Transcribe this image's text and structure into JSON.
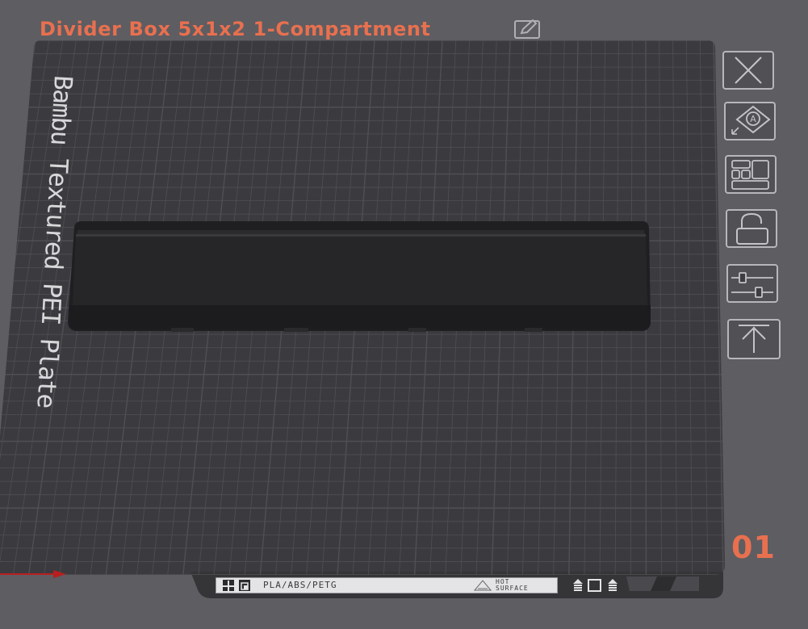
{
  "plate": {
    "title": "Divider Box 5x1x2 1-Compartment",
    "name": "Bambu Textured PEI Plate",
    "number": "01",
    "strip_label": "PLA/ABS/PETG",
    "hot_label_1": "HOT",
    "hot_label_2": "SURFACE"
  },
  "toolbar": {
    "buttons": [
      {
        "icon": "close-icon"
      },
      {
        "icon": "auto-orient-icon"
      },
      {
        "icon": "arrange-icon"
      },
      {
        "icon": "lock-icon"
      },
      {
        "icon": "plate-settings-icon"
      },
      {
        "icon": "move-to-top-icon"
      }
    ]
  },
  "colors": {
    "accent": "#e8704f",
    "background": "#5d5d62",
    "bed": "#3a3a3e",
    "grid": "#4f4f54",
    "model": "#232325"
  }
}
